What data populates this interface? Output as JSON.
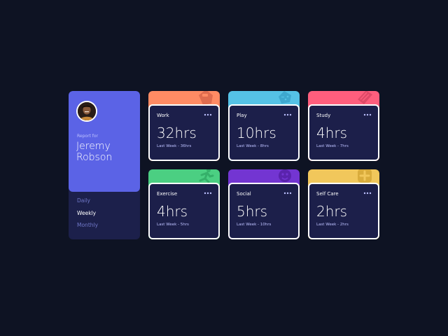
{
  "profile": {
    "report_for": "Report for",
    "name": "Jeremy Robson",
    "periods": [
      "Daily",
      "Weekly",
      "Monthly"
    ],
    "active_period": "Weekly"
  },
  "activities": [
    {
      "title": "Work",
      "hours": "32hrs",
      "previous": "Last Week - 36hrs",
      "color": "#ff8b64",
      "icon": "briefcase-icon"
    },
    {
      "title": "Play",
      "hours": "10hrs",
      "previous": "Last Week - 8hrs",
      "color": "#55c2e6",
      "icon": "gamepad-icon"
    },
    {
      "title": "Study",
      "hours": "4hrs",
      "previous": "Last Week - 7hrs",
      "color": "#ff5e7d",
      "icon": "book-icon"
    },
    {
      "title": "Exercise",
      "hours": "4hrs",
      "previous": "Last Week - 5hrs",
      "color": "#4bcf82",
      "icon": "running-icon"
    },
    {
      "title": "Social",
      "hours": "5hrs",
      "previous": "Last Week - 10hrs",
      "color": "#7335d2",
      "icon": "social-icon"
    },
    {
      "title": "Self Care",
      "hours": "2hrs",
      "previous": "Last Week - 2hrs",
      "color": "#f1c75b",
      "icon": "self-care-icon"
    }
  ],
  "colors": {
    "background": "#0e1323",
    "card": "#1c1f4a",
    "profile_accent": "#5b63e6",
    "muted_text": "#bdc1ff",
    "period_inactive": "#7078c9"
  }
}
